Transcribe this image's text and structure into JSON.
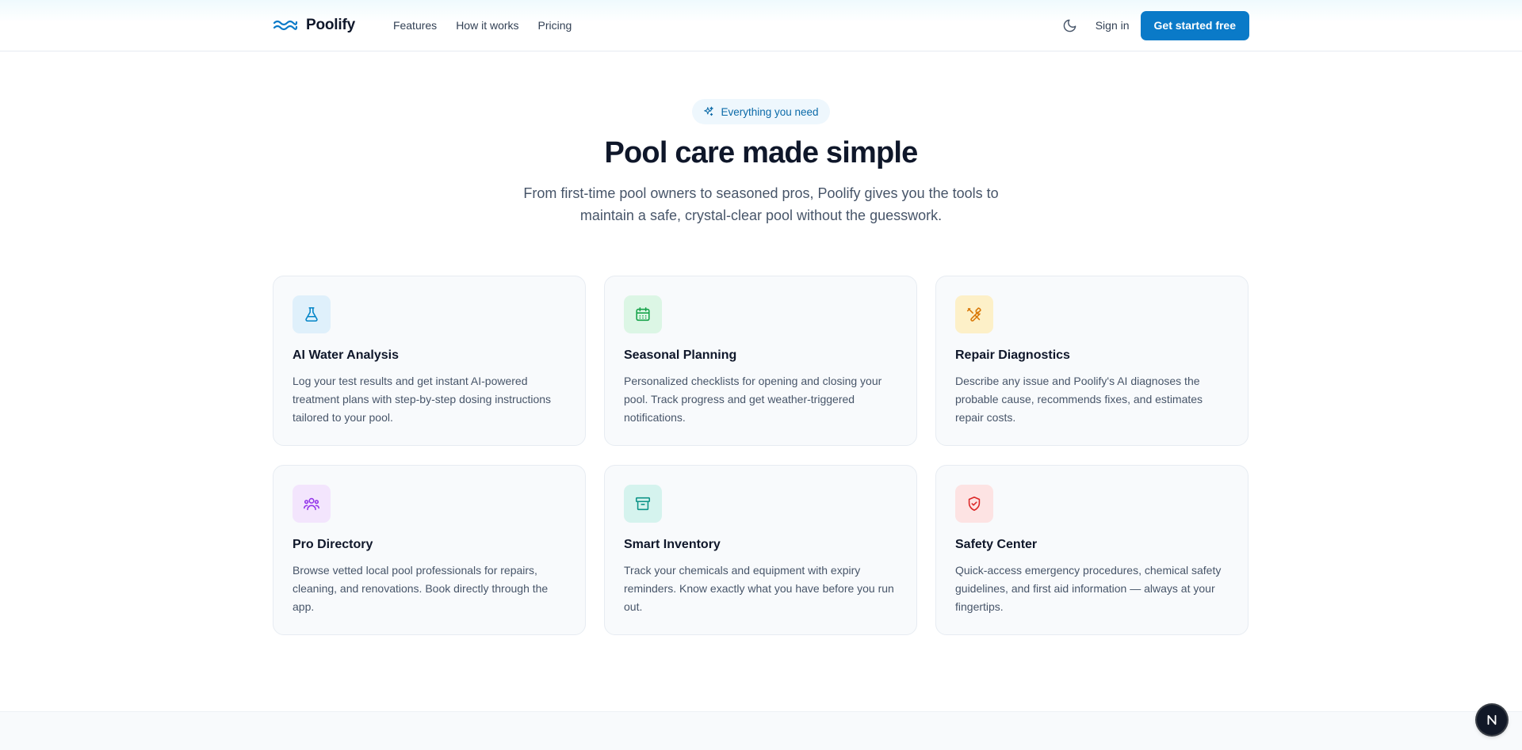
{
  "header": {
    "brand": "Poolify",
    "nav": [
      {
        "label": "Features"
      },
      {
        "label": "How it works"
      },
      {
        "label": "Pricing"
      }
    ],
    "theme_icon": "moon-icon",
    "signin_label": "Sign in",
    "cta_label": "Get started free",
    "accent_color": "#0a7ac8"
  },
  "hero": {
    "badge_icon": "sparkles-icon",
    "badge": "Everything you need",
    "title": "Pool care made simple",
    "subtitle": "From first-time pool owners to seasoned pros, Poolify gives you the tools to maintain a safe, crystal-clear pool without the guesswork."
  },
  "features": [
    {
      "icon": "flask-icon",
      "icon_color": "#0284c7",
      "icon_bg": "#dff0fb",
      "title": "AI Water Analysis",
      "desc": "Log your test results and get instant AI-powered treatment plans with step-by-step dosing instructions tailored to your pool."
    },
    {
      "icon": "calendar-icon",
      "icon_color": "#16a34a",
      "icon_bg": "#dcf6e5",
      "title": "Seasonal Planning",
      "desc": "Personalized checklists for opening and closing your pool. Track progress and get weather-triggered notifications."
    },
    {
      "icon": "wrench-icon",
      "icon_color": "#d97706",
      "icon_bg": "#fdf0c8",
      "title": "Repair Diagnostics",
      "desc": "Describe any issue and Poolify's AI diagnoses the probable cause, recommends fixes, and estimates repair costs."
    },
    {
      "icon": "users-icon",
      "icon_color": "#9333ea",
      "icon_bg": "#f3e5fd",
      "title": "Pro Directory",
      "desc": "Browse vetted local pool professionals for repairs, cleaning, and renovations. Book directly through the app."
    },
    {
      "icon": "archive-icon",
      "icon_color": "#0d9488",
      "icon_bg": "#d5f3ee",
      "title": "Smart Inventory",
      "desc": "Track your chemicals and equipment with expiry reminders. Know exactly what you have before you run out."
    },
    {
      "icon": "shield-check-icon",
      "icon_color": "#dc2626",
      "icon_bg": "#fde3e3",
      "title": "Safety Center",
      "desc": "Quick-access emergency procedures, chemical safety guidelines, and first aid information — always at your fingertips."
    }
  ],
  "floating": {
    "icon": "n-logo-icon",
    "letter": "N"
  }
}
